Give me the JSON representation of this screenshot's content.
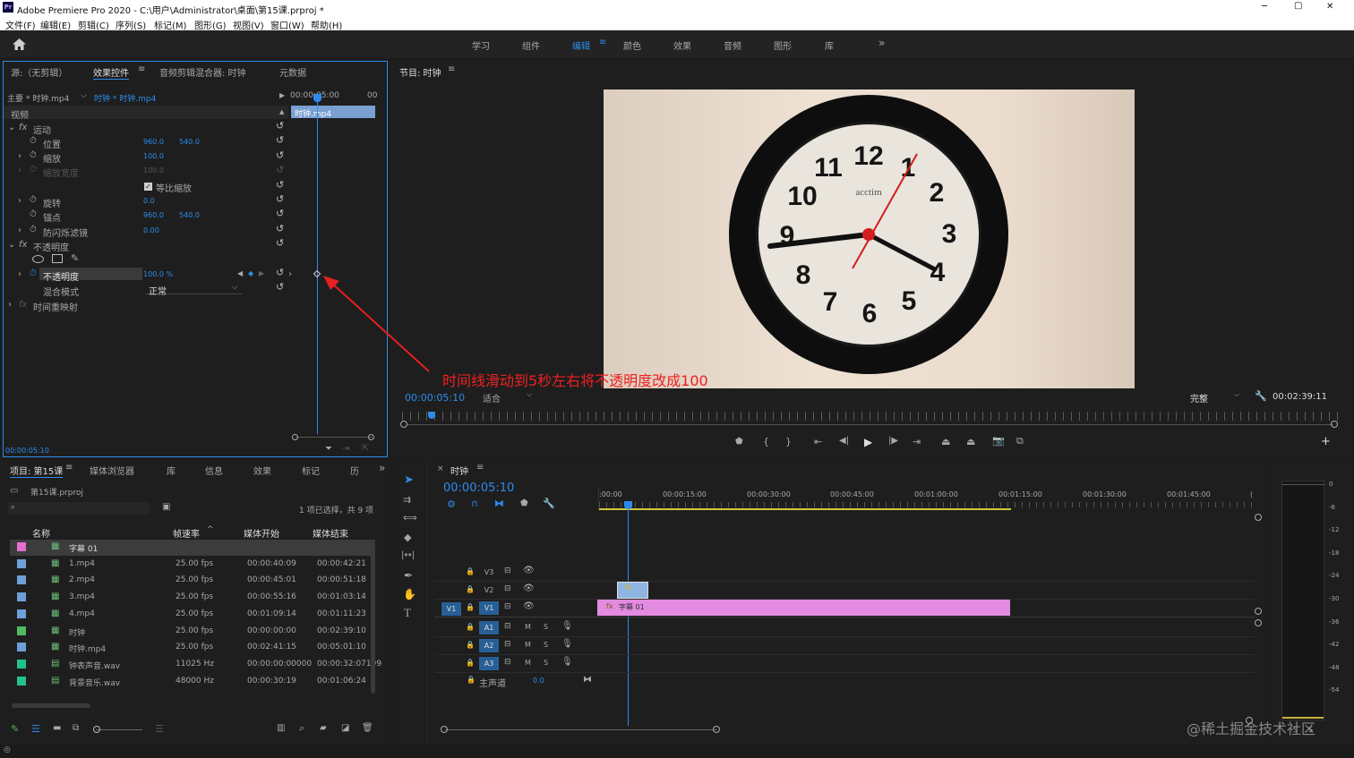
{
  "window": {
    "app_icon": "Pr",
    "title": "Adobe Premiere Pro 2020 - C:\\用户\\Administrator\\桌面\\第15课.prproj *",
    "min": "─",
    "max": "▢",
    "close": "✕"
  },
  "menu": [
    "文件(F)",
    "编辑(E)",
    "剪辑(C)",
    "序列(S)",
    "标记(M)",
    "图形(G)",
    "视图(V)",
    "窗口(W)",
    "帮助(H)"
  ],
  "workspaces": [
    "学习",
    "组件",
    "编辑",
    "颜色",
    "效果",
    "音频",
    "图形",
    "库"
  ],
  "workspace_active": "编辑",
  "workspace_more": "»",
  "effects_panel": {
    "tabs": [
      "源:（无剪辑）",
      "效果控件",
      "音频剪辑混合器: 时钟",
      "元数据"
    ],
    "menu_icon": "≡",
    "master": "主要 * 时钟.mp4",
    "clip": "时钟 * 时钟.mp4",
    "ruler_start": "00:00:05:00",
    "ruler_end": "00",
    "clip_bar": "时钟.mp4",
    "video_header": "视频",
    "motion": "运动",
    "position": {
      "label": "位置",
      "x": "960.0",
      "y": "540.0"
    },
    "scale": {
      "label": "缩放",
      "value": "100.0"
    },
    "scale_width": {
      "label": "缩放宽度",
      "value": "100.0"
    },
    "uniform_scale": "等比缩放",
    "rotation": {
      "label": "旋转",
      "value": "0.0"
    },
    "anchor": {
      "label": "锚点",
      "x": "960.0",
      "y": "540.0"
    },
    "anti_flicker": {
      "label": "防闪烁滤镜",
      "value": "0.00"
    },
    "opacity_section": "不透明度",
    "opacity": {
      "label": "不透明度",
      "value": "100.0 %"
    },
    "blend": {
      "label": "混合模式",
      "value": "正常"
    },
    "time_remap": "时间重映射",
    "timecode": "00:00:05:10"
  },
  "annotation": "时间线滑动到5秒左右将不透明度改成100",
  "program_monitor": {
    "tab": "节目: 时钟",
    "timecode": "00:00:05:10",
    "fit": "适合",
    "quality": "完整",
    "duration": "00:02:39:11",
    "clock_numbers": [
      "12",
      "1",
      "2",
      "3",
      "4",
      "5",
      "6",
      "7",
      "8",
      "9",
      "10",
      "11"
    ],
    "brand": "acctim"
  },
  "project_panel": {
    "tabs": [
      "项目: 第15课",
      "媒体浏览器",
      "库",
      "信息",
      "效果",
      "标记",
      "历"
    ],
    "more": "»",
    "file": "第15课.prproj",
    "status": "1 项已选择，共 9 项",
    "columns": [
      "名称",
      "帧速率",
      "媒体开始",
      "媒体结束"
    ],
    "items": [
      {
        "color": "#e36fcf",
        "name": "字幕 01",
        "fps": "",
        "start": "",
        "end": "",
        "selected": true
      },
      {
        "color": "#6f9fd8",
        "name": "1.mp4",
        "fps": "25.00 fps",
        "start": "00:00:40:09",
        "end": "00:00:42:21"
      },
      {
        "color": "#6f9fd8",
        "name": "2.mp4",
        "fps": "25.00 fps",
        "start": "00:00:45:01",
        "end": "00:00:51:18"
      },
      {
        "color": "#6f9fd8",
        "name": "3.mp4",
        "fps": "25.00 fps",
        "start": "00:00:55:16",
        "end": "00:01:03:14"
      },
      {
        "color": "#6f9fd8",
        "name": "4.mp4",
        "fps": "25.00 fps",
        "start": "00:01:09:14",
        "end": "00:01:11:23"
      },
      {
        "color": "#52b861",
        "name": "时钟",
        "fps": "25.00 fps",
        "start": "00:00:00:00",
        "end": "00:02:39:10"
      },
      {
        "color": "#6f9fd8",
        "name": "时钟.mp4",
        "fps": "25.00 fps",
        "start": "00:02:41:15",
        "end": "00:05:01:10"
      },
      {
        "color": "#22c08f",
        "name": "钟表声音.wav",
        "fps": "11025 Hz",
        "start": "00:00:00:00000",
        "end": "00:00:32:07199"
      },
      {
        "color": "#22c08f",
        "name": "背景音乐.wav",
        "fps": "48000 Hz",
        "start": "00:00:30:19",
        "end": "00:01:06:24"
      }
    ]
  },
  "timeline": {
    "tab": "时钟",
    "timecode": "00:00:05:10",
    "ruler": [
      ":00:00",
      "00:00:15:00",
      "00:00:30:00",
      "00:00:45:00",
      "00:01:00:00",
      "00:01:15:00",
      "00:01:30:00",
      "00:01:45:00",
      "("
    ],
    "tracks": [
      {
        "label": "V3",
        "type": "video"
      },
      {
        "label": "V2",
        "type": "video"
      },
      {
        "label": "V1",
        "type": "video",
        "source": "V1"
      },
      {
        "label": "A1",
        "type": "audio"
      },
      {
        "label": "A2",
        "type": "audio"
      },
      {
        "label": "A3",
        "type": "audio"
      }
    ],
    "master": "主声道",
    "master_value": "0.0",
    "clip_v1": "字幕 01",
    "mute": "M",
    "solo": "S"
  },
  "meter": {
    "ticks": [
      "0",
      "-6",
      "-12",
      "-18",
      "-24",
      "-30",
      "-36",
      "-42",
      "-48",
      "-54"
    ]
  },
  "watermark": "@稀土掘金技术社区"
}
